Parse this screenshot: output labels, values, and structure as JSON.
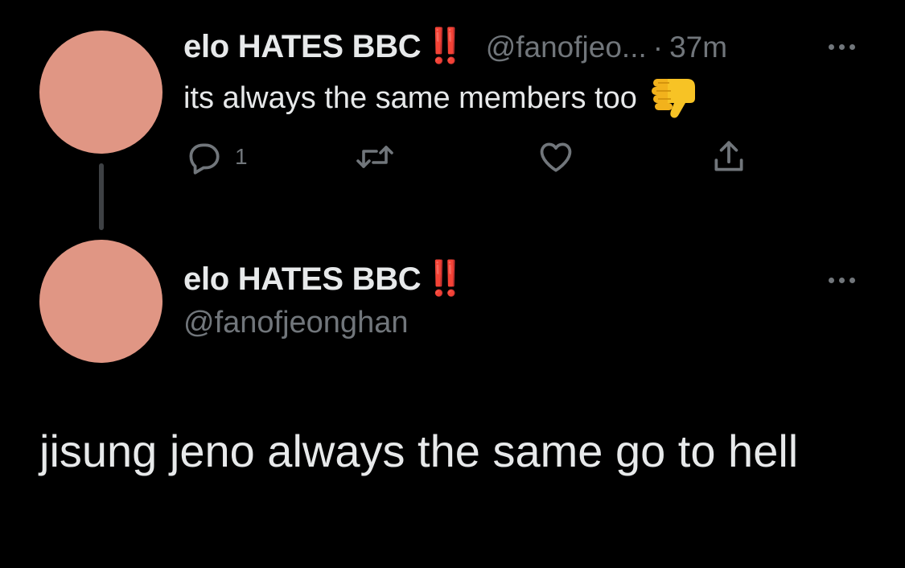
{
  "colors": {
    "background": "#000000",
    "text_primary": "#e7e9ea",
    "text_secondary": "#71767b",
    "avatar": "#e09684",
    "accent_red": "#e0302b"
  },
  "reply_tweet": {
    "display_name": "elo HATES BBC",
    "name_emoji": "‼️",
    "handle": "@fanofjeo...",
    "separator": "·",
    "time": "37m",
    "text": "its always the same members too",
    "text_emoji": "thumbs-down",
    "actions": {
      "reply_icon": "reply-icon",
      "reply_count": "1",
      "retweet_icon": "retweet-icon",
      "like_icon": "heart-icon",
      "share_icon": "share-icon"
    },
    "more_icon": "more-icon"
  },
  "main_tweet": {
    "display_name": "elo HATES BBC",
    "name_emoji": "‼️",
    "handle": "@fanofjeonghan",
    "text": "jisung jeno always the same go to hell",
    "more_icon": "more-icon"
  }
}
